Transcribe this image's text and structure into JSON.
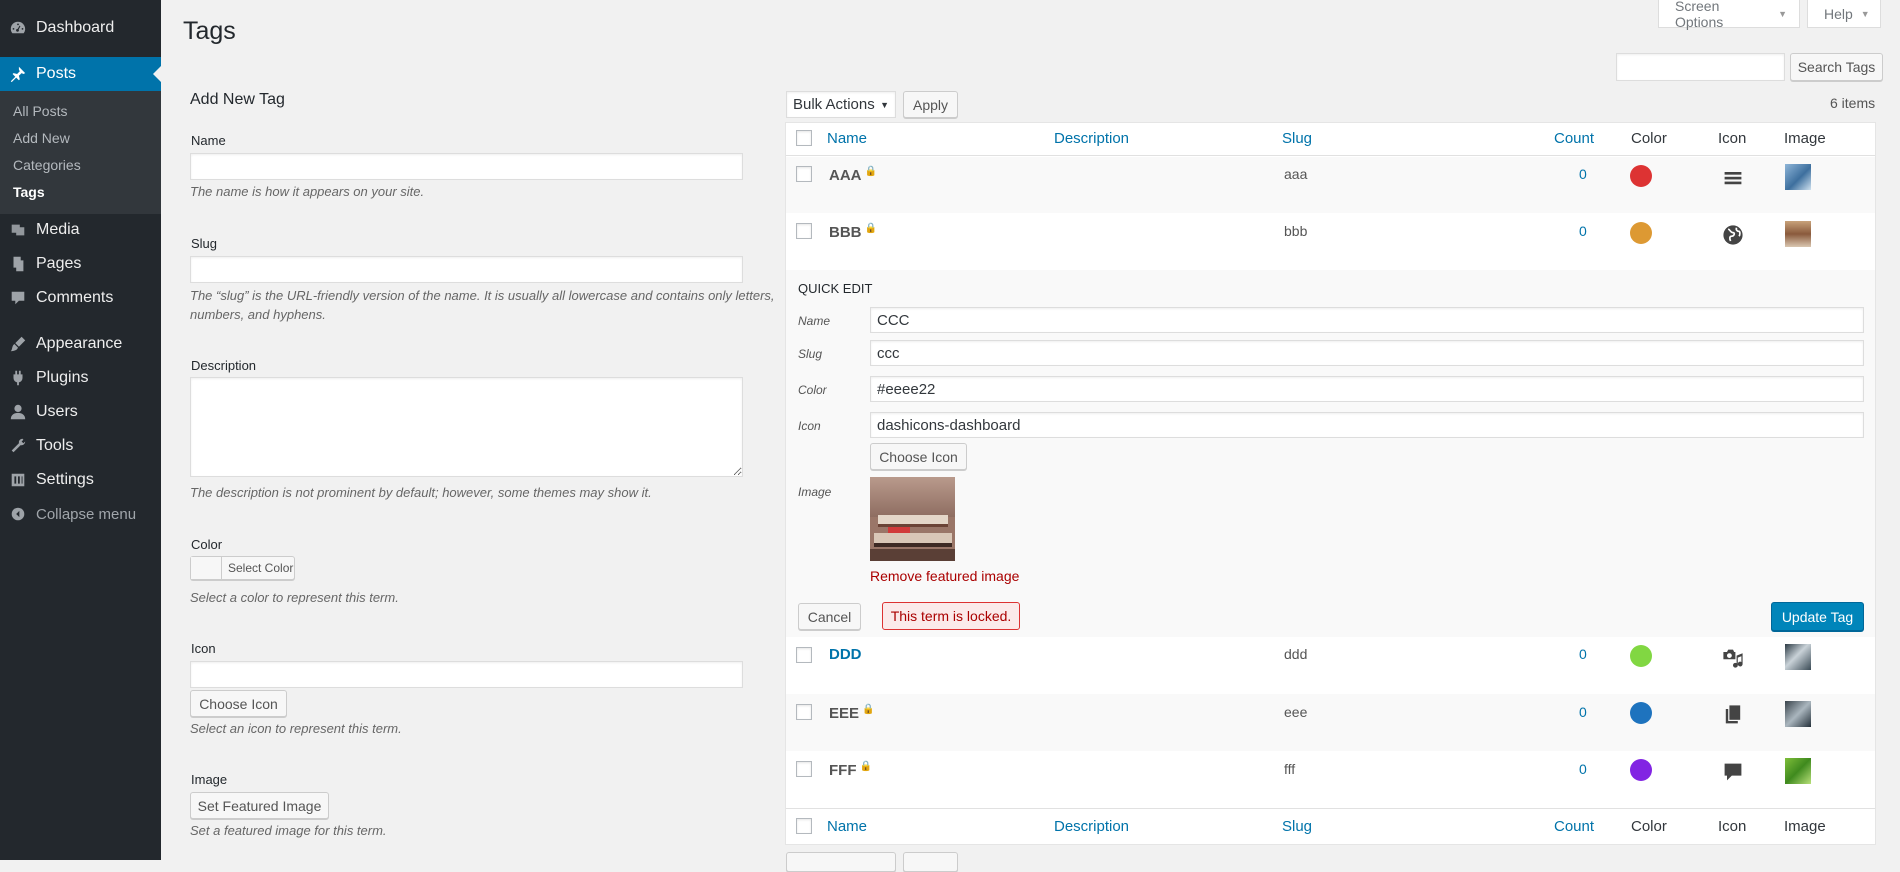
{
  "sidebar": {
    "items": [
      {
        "label": "Dashboard",
        "icon": "dashboard-icon"
      },
      {
        "label": "Posts",
        "icon": "pin-icon",
        "current": true
      },
      {
        "label": "Media",
        "icon": "media-icon"
      },
      {
        "label": "Pages",
        "icon": "pages-icon"
      },
      {
        "label": "Comments",
        "icon": "comment-icon"
      },
      {
        "label": "Appearance",
        "icon": "appearance-icon"
      },
      {
        "label": "Plugins",
        "icon": "plugin-icon"
      },
      {
        "label": "Users",
        "icon": "users-icon"
      },
      {
        "label": "Tools",
        "icon": "tools-icon"
      },
      {
        "label": "Settings",
        "icon": "settings-icon"
      }
    ],
    "submenu": [
      "All Posts",
      "Add New",
      "Categories",
      "Tags"
    ],
    "collapse_label": "Collapse menu"
  },
  "header": {
    "title": "Tags",
    "screen_options": "Screen Options",
    "help": "Help",
    "search_button": "Search Tags",
    "search_value": ""
  },
  "form": {
    "heading": "Add New Tag",
    "name_label": "Name",
    "name_help": "The name is how it appears on your site.",
    "slug_label": "Slug",
    "slug_help_1": "The “slug” is the URL-friendly version of the name. It is usually all lowercase and contains only letters,",
    "slug_help_2": "numbers, and hyphens.",
    "description_label": "Description",
    "description_help": "The description is not prominent by default; however, some themes may show it.",
    "color_label": "Color",
    "select_color": "Select Color",
    "color_help": "Select a color to represent this term.",
    "icon_label": "Icon",
    "choose_icon": "Choose Icon",
    "icon_help": "Select an icon to represent this term.",
    "image_label": "Image",
    "set_image": "Set Featured Image",
    "image_help": "Set a featured image for this term."
  },
  "toolbar": {
    "bulk_actions": "Bulk Actions",
    "apply": "Apply",
    "items_count": "6 items"
  },
  "table": {
    "columns": [
      "Name",
      "Description",
      "Slug",
      "Count",
      "Color",
      "Icon",
      "Image"
    ],
    "rows": [
      {
        "name": "AAA",
        "locked": true,
        "slug": "aaa",
        "count": "0",
        "color": "#dd3333",
        "icon": "menu-icon"
      },
      {
        "name": "BBB",
        "locked": true,
        "slug": "bbb",
        "count": "0",
        "color": "#dd9933",
        "icon": "globe-icon"
      },
      {
        "name": "DDD",
        "locked": false,
        "slug": "ddd",
        "count": "0",
        "color": "#81d742",
        "icon": "media-interactive-icon"
      },
      {
        "name": "EEE",
        "locked": true,
        "slug": "eee",
        "count": "0",
        "color": "#1e73be",
        "icon": "copy-icon"
      },
      {
        "name": "FFF",
        "locked": true,
        "slug": "fff",
        "count": "0",
        "color": "#8224e3",
        "icon": "speech-icon"
      }
    ]
  },
  "quick_edit": {
    "title": "QUICK EDIT",
    "name_label": "Name",
    "name_value": "CCC",
    "slug_label": "Slug",
    "slug_value": "ccc",
    "color_label": "Color",
    "color_value": "#eeee22",
    "icon_label": "Icon",
    "icon_value": "dashicons-dashboard",
    "choose_icon": "Choose Icon",
    "image_label": "Image",
    "remove_image": "Remove featured image",
    "cancel": "Cancel",
    "locked_notice": "This term is locked.",
    "update": "Update Tag"
  }
}
